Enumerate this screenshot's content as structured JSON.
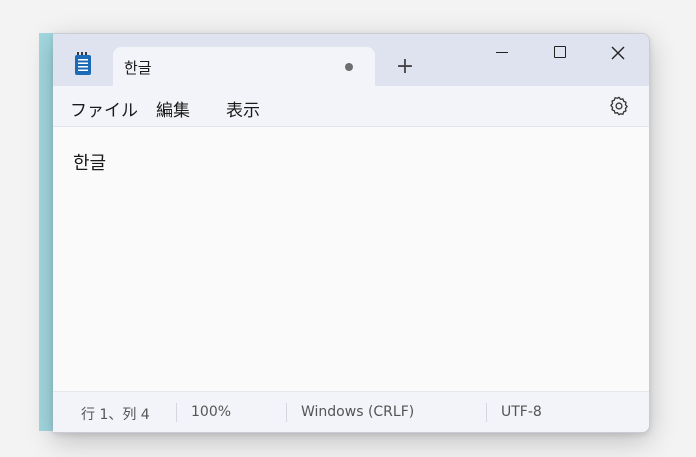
{
  "window": {
    "tab_title": "한글",
    "tab_modified_indicator": "●",
    "new_tab_label": "+",
    "app_icon": "notepad-icon"
  },
  "menu": {
    "file": "ファイル",
    "edit": "編集",
    "view": "表示",
    "settings_icon": "gear-icon"
  },
  "editor": {
    "content": "한글"
  },
  "status": {
    "position": "行 1、列 4",
    "zoom": "100%",
    "line_ending": "Windows (CRLF)",
    "encoding": "UTF-8"
  },
  "colors": {
    "titlebar": "#dfe3ef",
    "tab_active": "#f3f4f9",
    "editor_bg": "#fafafa",
    "app_icon": "#1b6ab8",
    "desktop_strip": "#a3d8e0"
  }
}
